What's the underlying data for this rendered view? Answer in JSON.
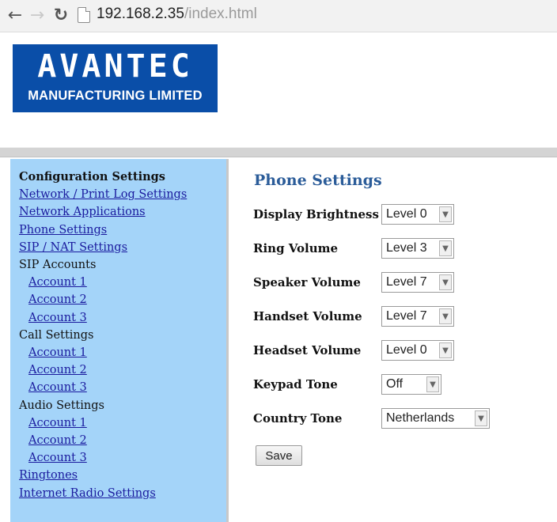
{
  "browser": {
    "url_host": "192.168.2.35",
    "url_path": "/index.html",
    "back_glyph": "←",
    "forward_glyph": "→",
    "reload_glyph": "↻"
  },
  "logo": {
    "word": "AVANTEC",
    "subtitle": "MANUFACTURING LIMITED",
    "color": "#0a4ea8"
  },
  "sidebar": {
    "background": "#a4d4f9",
    "heading": "Configuration Settings",
    "network_print": "Network / Print Log Settings",
    "network_apps": "Network Applications",
    "phone_settings": "Phone Settings",
    "sip_nat": "SIP / NAT Settings",
    "sip_accounts": "SIP Accounts",
    "call_settings": "Call Settings",
    "audio_settings": "Audio Settings",
    "account1": "Account 1",
    "account2": "Account 2",
    "account3": "Account 3",
    "ringtones": "Ringtones",
    "internet_radio": "Internet Radio Settings"
  },
  "main": {
    "title": "Phone Settings",
    "title_color": "#2b5c99",
    "fields": {
      "display_brightness": {
        "label": "Display Brightness",
        "value": "Level 0"
      },
      "ring_volume": {
        "label": "Ring Volume",
        "value": "Level 3"
      },
      "speaker_volume": {
        "label": "Speaker Volume",
        "value": "Level 7"
      },
      "handset_volume": {
        "label": "Handset Volume",
        "value": "Level 7"
      },
      "headset_volume": {
        "label": "Headset Volume",
        "value": "Level 0"
      },
      "keypad_tone": {
        "label": "Keypad Tone",
        "value": "Off"
      },
      "country_tone": {
        "label": "Country Tone",
        "value": "Netherlands"
      }
    },
    "save_label": "Save"
  }
}
